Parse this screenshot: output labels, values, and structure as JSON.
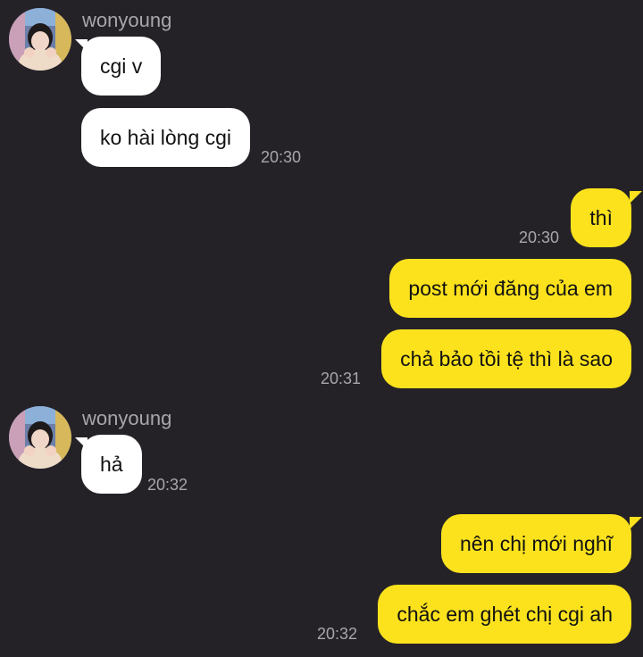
{
  "colors": {
    "background": "#252227",
    "incoming_bubble": "#ffffff",
    "outgoing_bubble": "#fbe21d",
    "meta_text": "#a9a6ab"
  },
  "contact": {
    "name": "wonyoung",
    "avatar_icon": "profile-photo"
  },
  "messages": [
    {
      "direction": "incoming",
      "text": "cgi v"
    },
    {
      "direction": "incoming",
      "text": "ko hài lòng cgi",
      "time": "20:30"
    },
    {
      "direction": "outgoing",
      "text": "thì",
      "time": "20:30"
    },
    {
      "direction": "outgoing",
      "text": "post mới đăng của em"
    },
    {
      "direction": "outgoing",
      "text": "chả bảo tồi tệ thì là sao",
      "time": "20:31"
    },
    {
      "direction": "incoming",
      "text": "hả",
      "time": "20:32"
    },
    {
      "direction": "outgoing",
      "text": "nên chị mới nghĩ"
    },
    {
      "direction": "outgoing",
      "text": "chắc em ghét chị cgi ah",
      "time": "20:32"
    }
  ]
}
